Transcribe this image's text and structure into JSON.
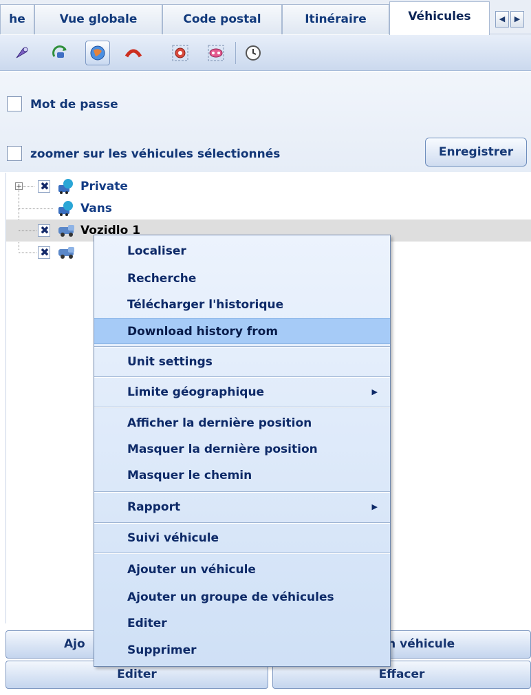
{
  "tabs": [
    {
      "label": "he",
      "active": false
    },
    {
      "label": "Vue globale",
      "active": false
    },
    {
      "label": "Code postal",
      "active": false
    },
    {
      "label": "Itinéraire",
      "active": false
    },
    {
      "label": "Véhicules",
      "active": true
    }
  ],
  "tab_scroll": {
    "left": "◀",
    "right": "▶"
  },
  "toolbar": {
    "icons": [
      "satellite-icon",
      "refresh-vehicles-icon",
      "globe-locate-icon",
      "hide-path-icon",
      "zoom-selected-icon",
      "zoom-all-icon",
      "clock-icon"
    ],
    "pressed": "globe-locate-icon"
  },
  "options": {
    "password_label": "Mot de passe",
    "zoom_label": "zoomer sur les véhicules sélectionnés",
    "save_label": "Enregistrer"
  },
  "tree": {
    "nodes": [
      {
        "label": "Private",
        "kind": "group",
        "checked": true,
        "expandable": true
      },
      {
        "label": "Vans",
        "kind": "group",
        "checked": false,
        "expandable": false
      },
      {
        "label": "Vozidlo 1",
        "kind": "vehicle",
        "checked": true,
        "selected": true
      },
      {
        "label": "",
        "kind": "vehicle",
        "checked": true,
        "selected": false
      }
    ]
  },
  "bottom_buttons": {
    "add_partial": "Ajo",
    "vehicle_partial": "un véhicule",
    "edit": "Editer",
    "clear": "Effacer"
  },
  "context_menu": {
    "items": [
      {
        "label": "Localiser"
      },
      {
        "label": "Recherche"
      },
      {
        "label": "Télécharger l'historique"
      },
      {
        "label": "Download history from",
        "highlighted": true
      },
      {
        "label": "Unit settings"
      },
      {
        "label": "Limite géographique",
        "submenu": true
      },
      {
        "label": "Afficher la dernière position"
      },
      {
        "label": "Masquer la dernière position"
      },
      {
        "label": "Masquer le chemin"
      },
      {
        "label": "Rapport",
        "submenu": true
      },
      {
        "label": "Suivi véhicule"
      },
      {
        "label": "Ajouter un véhicule"
      },
      {
        "label": "Ajouter un groupe de véhicules"
      },
      {
        "label": "Editer"
      },
      {
        "label": "Supprimer"
      }
    ],
    "submenu_arrow": "▶"
  },
  "colors": {
    "highlight": "#a6cbf7",
    "menu_bg": "#dce9f9",
    "text": "#10307a"
  }
}
